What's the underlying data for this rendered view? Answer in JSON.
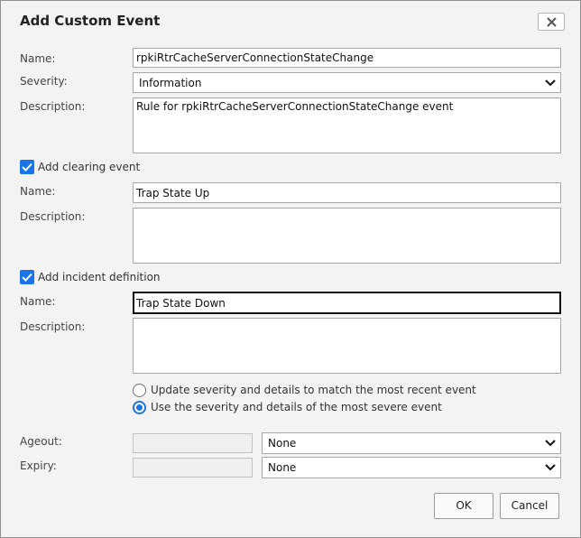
{
  "dialog": {
    "title": "Add Custom Event",
    "close_icon": "close-icon"
  },
  "event": {
    "name_label": "Name:",
    "name_value": "rpkiRtrCacheServerConnectionStateChange",
    "severity_label": "Severity:",
    "severity_value": "Information",
    "description_label": "Description:",
    "description_value": "Rule for rpkiRtrCacheServerConnectionStateChange event"
  },
  "clearing": {
    "checkbox_label": "Add clearing event",
    "checked": true,
    "name_label": "Name:",
    "name_value": "Trap State Up",
    "description_label": "Description:",
    "description_value": ""
  },
  "incident": {
    "checkbox_label": "Add incident definition",
    "checked": true,
    "name_label": "Name:",
    "name_value": "Trap State Down",
    "description_label": "Description:",
    "description_value": "",
    "options": [
      {
        "label": "Update severity and details to match the most recent event",
        "selected": false
      },
      {
        "label": "Use the severity and details of the most severe event",
        "selected": true
      }
    ]
  },
  "timing": {
    "ageout_label": "Ageout:",
    "ageout_value": "",
    "ageout_unit": "None",
    "expiry_label": "Expiry:",
    "expiry_value": "",
    "expiry_unit": "None"
  },
  "buttons": {
    "ok": "OK",
    "cancel": "Cancel"
  },
  "colors": {
    "accent": "#1a73e8",
    "dialog_bg": "#f3f3f3"
  }
}
